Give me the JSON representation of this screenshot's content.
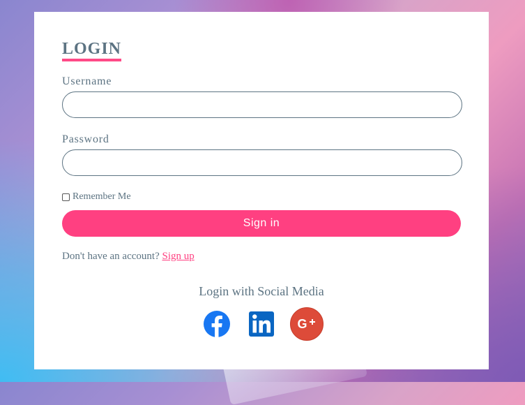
{
  "login": {
    "title": "LOGIN",
    "username_label": "Username",
    "username_value": "",
    "password_label": "Password",
    "password_value": "",
    "remember_label": "Remember Me",
    "remember_checked": false,
    "signin_label": "Sign in",
    "no_account_text": "Don't have an account?",
    "signup_label": "Sign up",
    "social_title": "Login with Social Media",
    "social_icons": [
      "facebook-icon",
      "linkedin-icon",
      "google-plus-icon"
    ]
  },
  "colors": {
    "accent": "#ff4081",
    "text": "#5c7382",
    "facebook": "#1877f2",
    "linkedin": "#0a66c2",
    "google_plus": "#dd4b39"
  }
}
